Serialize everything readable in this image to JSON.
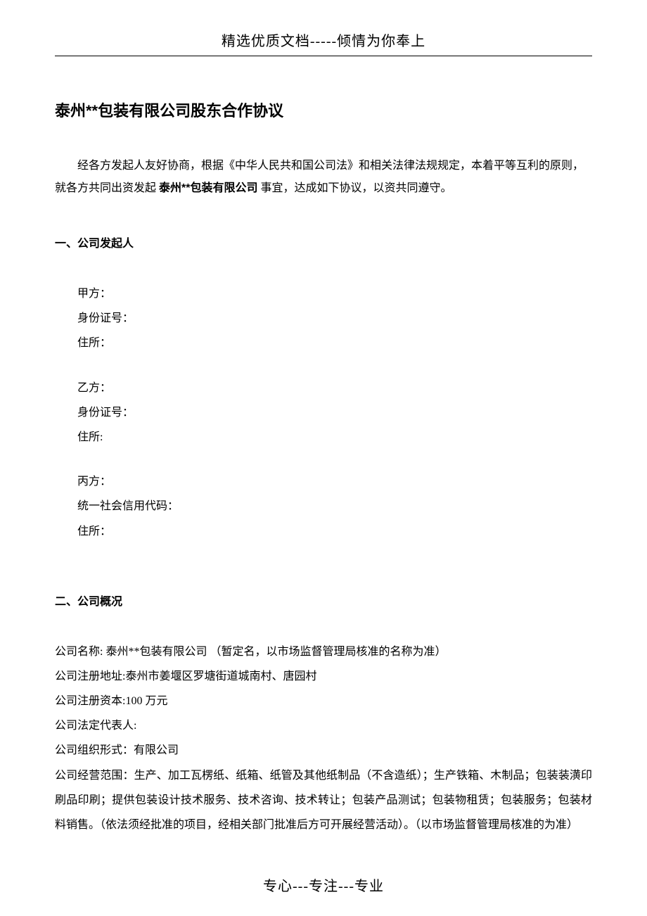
{
  "header": {
    "text": "精选优质文档-----倾情为你奉上"
  },
  "title": "泰州**包装有限公司股东合作协议",
  "intro": {
    "part1": "经各方发起人友好协商，根据《中华人民共和国公司法》和相关法律法规规定，本着平等互利的原则，就各方共同出资发起 ",
    "bold": "泰州**包装有限公司",
    "part2": " 事宜，达成如下协议，以资共同遵守。"
  },
  "section1": {
    "title": "一、公司发起人",
    "parties": [
      {
        "name": "甲方：",
        "id_label": "身份证号：",
        "addr_label": "住所："
      },
      {
        "name": "乙方：",
        "id_label": "身份证号：",
        "addr_label": "住所:"
      },
      {
        "name": "丙方：",
        "id_label": "统一社会信用代码：",
        "addr_label": "住所："
      }
    ]
  },
  "section2": {
    "title": "二、公司概况",
    "lines": [
      "公司名称: 泰州**包装有限公司 （暂定名，以市场监督管理局核准的名称为准）",
      "公司注册地址:泰州市姜堰区罗塘街道城南村、唐园村",
      "公司注册资本:100 万元",
      "公司法定代表人:",
      "公司组织形式：有限公司"
    ],
    "scope": "公司经营范围：生产、加工瓦楞纸、纸箱、纸管及其他纸制品（不含造纸）；生产铁箱、木制品；包装装潢印刷品印刷；提供包装设计技术服务、技术咨询、技术转让；包装产品测试；包装物租赁；包装服务；包装材料销售。（依法须经批准的项目，经相关部门批准后方可开展经营活动）。（以市场监督管理局核准的为准）"
  },
  "footer": {
    "text": "专心---专注---专业"
  }
}
